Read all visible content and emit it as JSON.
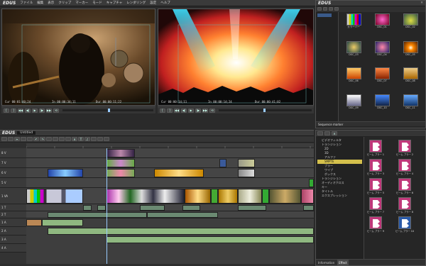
{
  "app": {
    "logo": "EDUS",
    "menu": [
      "ファイル",
      "編集",
      "表示",
      "クリップ",
      "マーカー",
      "モード",
      "キャプチャ",
      "レンダリング",
      "設定",
      "ヘルプ"
    ]
  },
  "player": {
    "in_label": "Cur 00:01:40;24",
    "out_label": "Out 00:00:11;22",
    "dur_label": "Dur 00:00:11;22",
    "in_time": "In 00:00:34;11"
  },
  "recorder": {
    "in_label": "Cur 00:00:14;11",
    "out_label": "Out 00:00:14;11",
    "dur_label": "Dur 00:00:41;02",
    "in_time": "In 00:00:14;24"
  },
  "bin": {
    "title": "EDUS",
    "thumbnails": [
      {
        "label": "カラーバー",
        "color": "#6e3a7a"
      },
      {
        "label": "DSC_01",
        "color": "#7a2830"
      },
      {
        "label": "DSC_02",
        "color": "#5a6230"
      },
      {
        "label": "DSC_03",
        "color": "#2a5a4a"
      },
      {
        "label": "DSC_04",
        "color": "#2a3a6e"
      },
      {
        "label": "DSC_05",
        "color": "#a04010"
      },
      {
        "label": "DSC_06",
        "color": "#d07818"
      },
      {
        "label": "DSC_07",
        "color": "#b04020"
      },
      {
        "label": "DSC_08",
        "color": "#c88020"
      },
      {
        "label": "DSC_09",
        "color": "#a0a0c0"
      },
      {
        "label": "DSC_10",
        "color": "#2050a0"
      },
      {
        "label": "DSC_11",
        "color": "#1a4a8a"
      }
    ],
    "footer_tabs": [
      "Sequence marker"
    ]
  },
  "timeline": {
    "logo": "EDUS",
    "seq_name": "Untitled",
    "tracks": [
      {
        "name": "8 V"
      },
      {
        "name": "7 V"
      },
      {
        "name": "6 V"
      },
      {
        "name": "5 V"
      },
      {
        "name": "1 VA"
      },
      {
        "name": "1 T"
      },
      {
        "name": "2 T"
      },
      {
        "name": "1 A"
      },
      {
        "name": "2 A"
      },
      {
        "name": "3 A"
      },
      {
        "name": "4 A"
      }
    ]
  },
  "effects": {
    "tree": [
      "ビデオフィルタ",
      "トランジション",
      "2D",
      "3D",
      "アルファ",
      "SMPTE",
      "ブラー",
      "ワイプ",
      "ボックス",
      "トランジション",
      "オーディオクロス",
      "キー",
      "タイトル",
      "エクスプレッション"
    ],
    "selected_index": 5,
    "items": [
      {
        "label": "ビーム ブラー 1"
      },
      {
        "label": "ビーム ブラー 2"
      },
      {
        "label": "ビーム ブラー 3"
      },
      {
        "label": "ビーム ブラー 4"
      },
      {
        "label": "ビーム ブラー 5"
      },
      {
        "label": "ビーム ブラー 6"
      },
      {
        "label": "ビーム ブラー 7"
      },
      {
        "label": "ビーム ブラー 8"
      },
      {
        "label": "ビーム ブラー 9"
      },
      {
        "label": "ビーム ブラー 10"
      }
    ],
    "footer_tabs": [
      "Information",
      "Effect"
    ]
  }
}
